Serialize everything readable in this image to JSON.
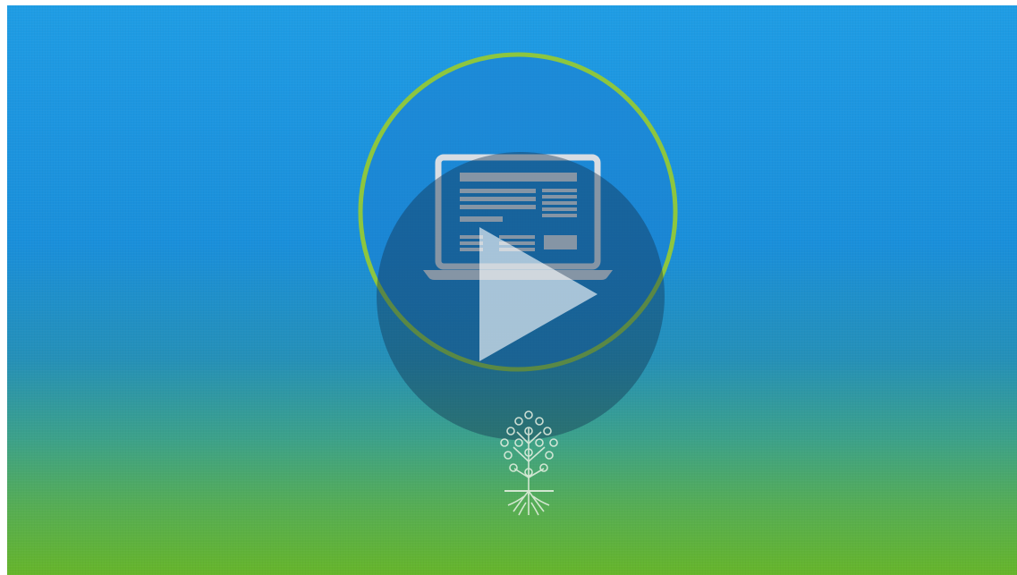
{
  "video": {
    "state": "paused",
    "play_button_icon": "play-icon",
    "thumbnail_icon": "laptop-icon",
    "logo_icon": "tree-roots-logo"
  },
  "colors": {
    "gradient_top": "#1f9de4",
    "gradient_middle": "#1a8fda",
    "gradient_bottom": "#66b52a",
    "ring": "#8dc63f",
    "play_overlay": "rgba(20,50,80,0.45)",
    "icon_stroke": "#d8dde3"
  }
}
